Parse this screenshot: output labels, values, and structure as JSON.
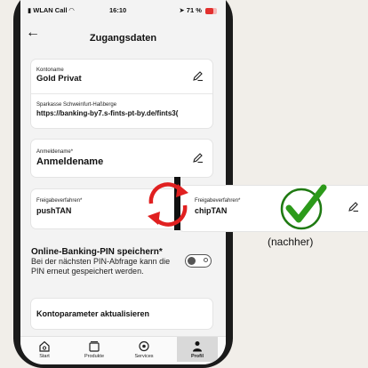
{
  "status_bar": {
    "carrier": "WLAN Call",
    "time": "16:10",
    "battery": "71 %"
  },
  "header": {
    "back_icon": "arrow-left-icon",
    "title": "Zugangsdaten"
  },
  "account_card": {
    "kontoname_label": "Kontoname",
    "kontoname_value": "Gold Privat",
    "bank_label": "Sparkasse Schweinfurt-Haßberge",
    "bank_url": "https://banking-by7.s-fints-pt-by.de/fints3("
  },
  "login_card": {
    "label": "Anmeldename*",
    "value": "Anmeldename"
  },
  "freigabe_before": {
    "label": "Freigabeverfahren*",
    "value": "pushTAN"
  },
  "freigabe_after": {
    "label": "Freigabeverfahren*",
    "value": "chipTAN",
    "caption": "(nachher)"
  },
  "pin_setting": {
    "title": "Online-Banking-PIN speichern*",
    "description": "Bei der nächsten PIN-Abfrage kann die PIN erneut gespeichert werden.",
    "enabled": false
  },
  "update_button": {
    "label": "Kontoparameter aktualisieren"
  },
  "tabbar": {
    "tabs": [
      {
        "label": "Start",
        "icon": "home-icon"
      },
      {
        "label": "Produkte",
        "icon": "wallet-icon"
      },
      {
        "label": "Services",
        "icon": "services-icon"
      },
      {
        "label": "Profil",
        "icon": "person-icon",
        "active": true
      }
    ]
  },
  "colors": {
    "swap_arrows": "#e02020",
    "checkmark": "#2c9a1a",
    "checkmark_ring": "#1f7a12",
    "frame": "#1b1b1b"
  }
}
